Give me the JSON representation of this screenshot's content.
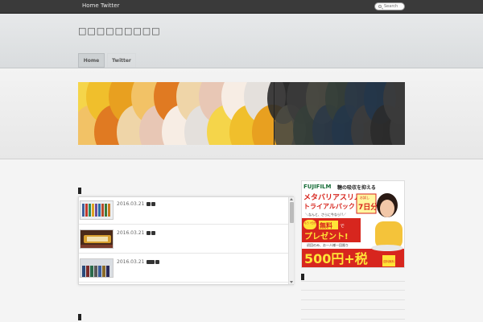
{
  "top_nav": {
    "items": [
      "Home",
      "Twitter"
    ]
  },
  "search": {
    "placeholder": "Search"
  },
  "site": {
    "title": "□□□□□□□□□"
  },
  "main_nav": {
    "items": [
      "Home",
      "Twitter"
    ],
    "active": "Home"
  },
  "banner": {
    "colors_left": [
      "#f5d54a",
      "#f0bf2c",
      "#e8a020",
      "#f2c266",
      "#e07a22",
      "#efd5a8",
      "#e8c7b5",
      "#f7ede4",
      "#e4e0dc"
    ],
    "colors_right": [
      "#2b2b2b",
      "#3b3b3b",
      "#4a4a42",
      "#353f3a",
      "#2b3847",
      "#24364a",
      "#3c3c3c"
    ]
  },
  "posts": [
    {
      "date": "2016.03.21 :",
      "tags": 2
    },
    {
      "date": "2016.03.21 :",
      "tags": 2
    },
    {
      "date": "2016.03.21 :",
      "tags": 2
    }
  ],
  "ad": {
    "brand": "FUJIFILM",
    "headline": "糖の吸収を抑える",
    "product": "メタバリアスリム",
    "pack": "トライアルパック",
    "pack_badge": "お試し",
    "days": "7日分",
    "promo_line": "＼なんと、さらに今なら!!／",
    "extra": "もう 7日分を",
    "free": "無料",
    "free_suffix": "で",
    "present": "プレゼント!",
    "note": "初回のみ、お一人様一回限り",
    "price": "500円+税",
    "shipping": "送料無料",
    "colors": {
      "red": "#d7261e",
      "yellow": "#ffe437",
      "brand_green": "#1a6e3a"
    }
  }
}
